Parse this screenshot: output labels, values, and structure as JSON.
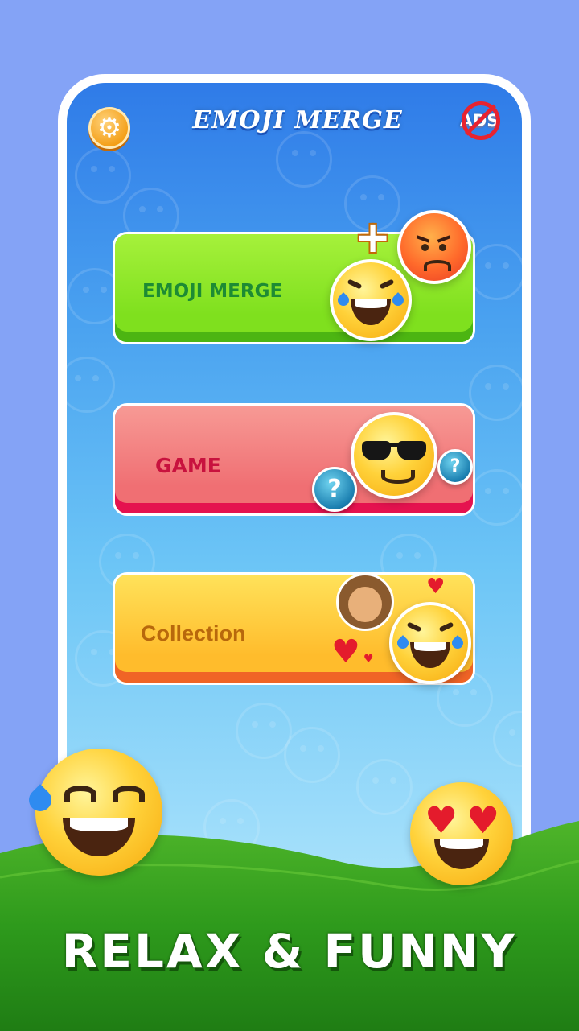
{
  "header": {
    "title": "EMOJI MERGE",
    "settings_icon": "gear-icon",
    "noads_label": "ADS",
    "noads_icon": "no-ads-icon"
  },
  "menu": [
    {
      "label": "EMOJI MERGE",
      "color": "#7fe01e",
      "text_color": "#1d8b34"
    },
    {
      "label": "GAME",
      "color": "#f06f73",
      "text_color": "#c8123e"
    },
    {
      "label": "Collection",
      "color": "#ffbc2c",
      "text_color": "#b8680c"
    }
  ],
  "question_mark": "?",
  "tagline": "RELAX & FUNNY",
  "colors": {
    "background": "#84a3f6",
    "grass": "#2e9a1c"
  }
}
